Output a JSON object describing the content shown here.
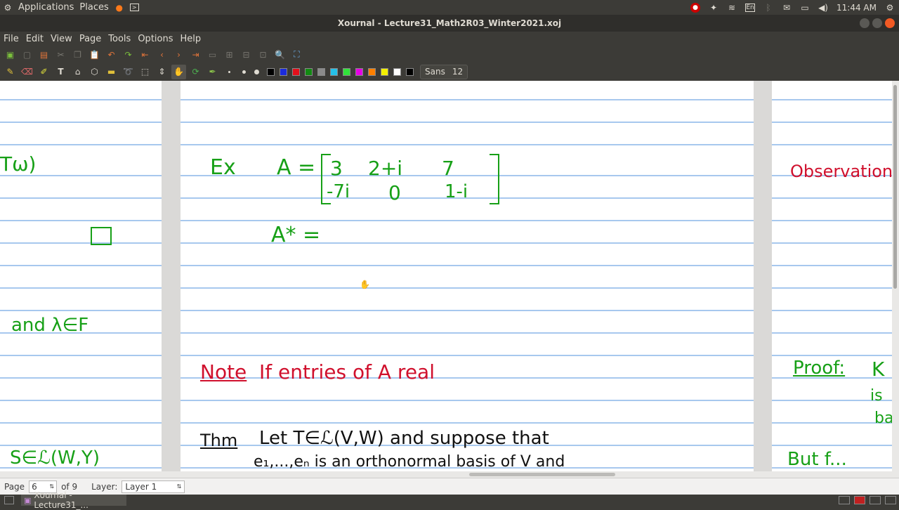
{
  "topbar": {
    "applications": "Applications",
    "places": "Places",
    "keyboard": "En",
    "clock": "11:44 AM"
  },
  "window": {
    "title": "Xournal - Lecture31_Math2R03_Winter2021.xoj"
  },
  "menu": {
    "file": "File",
    "edit": "Edit",
    "view": "View",
    "page": "Page",
    "tools": "Tools",
    "options": "Options",
    "help": "Help"
  },
  "colors": {
    "palette": [
      "#000000",
      "#1b2bdc",
      "#e3101c",
      "#128a12",
      "#8a8a8a",
      "#25c0e8",
      "#31e33a",
      "#e600e6",
      "#ff8000",
      "#f4f000",
      "#ffffff",
      "#000000"
    ],
    "ink_green": "#17a017",
    "ink_red": "#d0102d",
    "rule_blue": "#a7c8ee"
  },
  "font": {
    "name": "Sans",
    "size": "12"
  },
  "canvas": {
    "left_page": {
      "frag1": "Tω)",
      "frag_box": "□",
      "frag2": "and λ∈F",
      "frag3": "S∈ℒ(W,Y)"
    },
    "center_page": {
      "ex_label": "Ex",
      "matrix_lhs": "A =",
      "row1": [
        "3",
        "2+i",
        "7"
      ],
      "row2": [
        "-7i",
        "0",
        "1-i"
      ],
      "adjoint": "A* =",
      "note_label": "Note",
      "note_text": "If entries of A real",
      "thm_label": "Thm",
      "thm_line1": "Let T∈ℒ(V,W) and suppose that",
      "thm_line2": "e₁,...,eₙ is an orthonormal basis of V and"
    },
    "right_page": {
      "observation": "Observation",
      "proof": "Proof:",
      "proof_k": "K",
      "frag_is": "is",
      "frag_ba": "ba",
      "but": "But  f..."
    }
  },
  "statusbar": {
    "page_label": "Page",
    "page_value": "6",
    "of_pages": "of 9",
    "layer_label": "Layer:",
    "layer_value": "Layer 1"
  },
  "taskbar": {
    "task_label": "Xournal - Lecture31_..."
  }
}
